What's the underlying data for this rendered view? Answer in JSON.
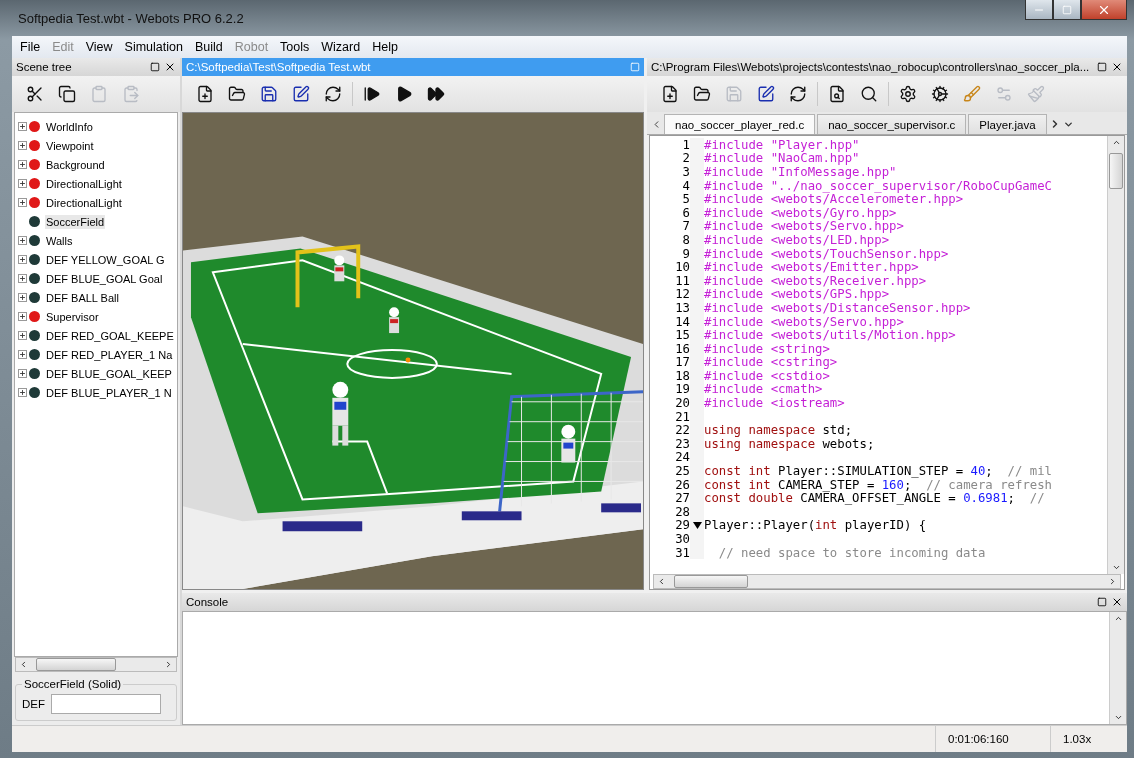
{
  "window": {
    "title": "Softpedia Test.wbt - Webots PRO 6.2.2"
  },
  "menu": [
    {
      "label": "File",
      "disabled": false
    },
    {
      "label": "Edit",
      "disabled": true
    },
    {
      "label": "View",
      "disabled": false
    },
    {
      "label": "Simulation",
      "disabled": false
    },
    {
      "label": "Build",
      "disabled": false
    },
    {
      "label": "Robot",
      "disabled": true
    },
    {
      "label": "Tools",
      "disabled": false
    },
    {
      "label": "Wizard",
      "disabled": false
    },
    {
      "label": "Help",
      "disabled": false
    }
  ],
  "scene_tree": {
    "title": "Scene tree",
    "toolbar": [
      {
        "kind": "cut",
        "disabled": false
      },
      {
        "kind": "copy",
        "disabled": false
      },
      {
        "kind": "paste",
        "disabled": true
      },
      {
        "kind": "insert",
        "disabled": true
      }
    ],
    "nodes": [
      {
        "label": "WorldInfo",
        "color": "#e01818",
        "expandable": true,
        "selected": false
      },
      {
        "label": "Viewpoint",
        "color": "#e01818",
        "expandable": true,
        "selected": false
      },
      {
        "label": "Background",
        "color": "#e01818",
        "expandable": true,
        "selected": false
      },
      {
        "label": "DirectionalLight",
        "color": "#e01818",
        "expandable": true,
        "selected": false
      },
      {
        "label": "DirectionalLight",
        "color": "#e01818",
        "expandable": true,
        "selected": false
      },
      {
        "label": "SoccerField",
        "color": "#1f3a38",
        "expandable": false,
        "selected": true
      },
      {
        "label": "Walls",
        "color": "#1f3a38",
        "expandable": true,
        "selected": false
      },
      {
        "label": "DEF YELLOW_GOAL G",
        "color": "#1f3a38",
        "expandable": true,
        "selected": false
      },
      {
        "label": "DEF BLUE_GOAL Goal",
        "color": "#1f3a38",
        "expandable": true,
        "selected": false
      },
      {
        "label": "DEF BALL Ball",
        "color": "#1f3a38",
        "expandable": true,
        "selected": false
      },
      {
        "label": "Supervisor",
        "color": "#e01818",
        "expandable": true,
        "selected": false
      },
      {
        "label": "DEF RED_GOAL_KEEPE",
        "color": "#1f3a38",
        "expandable": true,
        "selected": false
      },
      {
        "label": "DEF RED_PLAYER_1 Na",
        "color": "#1f3a38",
        "expandable": true,
        "selected": false
      },
      {
        "label": "DEF BLUE_GOAL_KEEP",
        "color": "#1f3a38",
        "expandable": true,
        "selected": false
      },
      {
        "label": "DEF BLUE_PLAYER_1 N",
        "color": "#1f3a38",
        "expandable": true,
        "selected": false
      }
    ],
    "properties": {
      "title": "SoccerField (Solid)",
      "field_label": "DEF"
    }
  },
  "view3d": {
    "title": "C:\\Softpedia\\Test\\Softpedia Test.wbt",
    "active": true,
    "toolbar": [
      {
        "kind": "new",
        "disabled": false
      },
      {
        "kind": "open",
        "disabled": false
      },
      {
        "kind": "save",
        "disabled": false
      },
      {
        "kind": "save_as",
        "disabled": false
      },
      {
        "kind": "revert",
        "disabled": false
      },
      {
        "kind": "step",
        "disabled": false
      },
      {
        "kind": "run",
        "disabled": false
      },
      {
        "kind": "fast",
        "disabled": false
      }
    ]
  },
  "editor": {
    "title": "C:\\Program Files\\Webots\\projects\\contests\\nao_robocup\\controllers\\nao_soccer_pla...",
    "active": false,
    "toolbar": [
      {
        "kind": "new",
        "disabled": false
      },
      {
        "kind": "open",
        "disabled": false
      },
      {
        "kind": "save",
        "disabled": true
      },
      {
        "kind": "save_as",
        "disabled": false
      },
      {
        "kind": "revert",
        "disabled": false
      },
      {
        "kind": "find",
        "disabled": false
      },
      {
        "kind": "replace",
        "disabled": false
      },
      {
        "kind": "build",
        "disabled": false
      },
      {
        "kind": "compile",
        "disabled": false
      },
      {
        "kind": "clean",
        "disabled": false
      },
      {
        "kind": "cross_compile",
        "disabled": true
      },
      {
        "kind": "cross_clean",
        "disabled": true
      }
    ],
    "tabs": [
      {
        "label": "nao_soccer_player_red.c",
        "selected": true
      },
      {
        "label": "nao_soccer_supervisor.c",
        "selected": false
      },
      {
        "label": "Player.java",
        "selected": false
      }
    ],
    "lines": [
      {
        "number": "1",
        "fold": false,
        "tokens": [
          {
            "kind": "directive",
            "text": "#include \"Player.hpp\""
          }
        ]
      },
      {
        "number": "2",
        "fold": false,
        "tokens": [
          {
            "kind": "directive",
            "text": "#include \"NaoCam.hpp\""
          }
        ]
      },
      {
        "number": "3",
        "fold": false,
        "tokens": [
          {
            "kind": "directive",
            "text": "#include \"InfoMessage.hpp\""
          }
        ]
      },
      {
        "number": "4",
        "fold": false,
        "tokens": [
          {
            "kind": "directive",
            "text": "#include \"../nao_soccer_supervisor/RoboCupGameC"
          }
        ]
      },
      {
        "number": "5",
        "fold": false,
        "tokens": [
          {
            "kind": "directive",
            "text": "#include <webots/Accelerometer.hpp>"
          }
        ]
      },
      {
        "number": "6",
        "fold": false,
        "tokens": [
          {
            "kind": "directive",
            "text": "#include <webots/Gyro.hpp>"
          }
        ]
      },
      {
        "number": "7",
        "fold": false,
        "tokens": [
          {
            "kind": "directive",
            "text": "#include <webots/Servo.hpp>"
          }
        ]
      },
      {
        "number": "8",
        "fold": false,
        "tokens": [
          {
            "kind": "directive",
            "text": "#include <webots/LED.hpp>"
          }
        ]
      },
      {
        "number": "9",
        "fold": false,
        "tokens": [
          {
            "kind": "directive",
            "text": "#include <webots/TouchSensor.hpp>"
          }
        ]
      },
      {
        "number": "10",
        "fold": false,
        "tokens": [
          {
            "kind": "directive",
            "text": "#include <webots/Emitter.hpp>"
          }
        ]
      },
      {
        "number": "11",
        "fold": false,
        "tokens": [
          {
            "kind": "directive",
            "text": "#include <webots/Receiver.hpp>"
          }
        ]
      },
      {
        "number": "12",
        "fold": false,
        "tokens": [
          {
            "kind": "directive",
            "text": "#include <webots/GPS.hpp>"
          }
        ]
      },
      {
        "number": "13",
        "fold": false,
        "tokens": [
          {
            "kind": "directive",
            "text": "#include <webots/DistanceSensor.hpp>"
          }
        ]
      },
      {
        "number": "14",
        "fold": false,
        "tokens": [
          {
            "kind": "directive",
            "text": "#include <webots/Servo.hpp>"
          }
        ]
      },
      {
        "number": "15",
        "fold": false,
        "tokens": [
          {
            "kind": "directive",
            "text": "#include <webots/utils/Motion.hpp>"
          }
        ]
      },
      {
        "number": "16",
        "fold": false,
        "tokens": [
          {
            "kind": "directive",
            "text": "#include <string>"
          }
        ]
      },
      {
        "number": "17",
        "fold": false,
        "tokens": [
          {
            "kind": "directive",
            "text": "#include <cstring>"
          }
        ]
      },
      {
        "number": "18",
        "fold": false,
        "tokens": [
          {
            "kind": "directive",
            "text": "#include <cstdio>"
          }
        ]
      },
      {
        "number": "19",
        "fold": false,
        "tokens": [
          {
            "kind": "directive",
            "text": "#include <cmath>"
          }
        ]
      },
      {
        "number": "20",
        "fold": false,
        "tokens": [
          {
            "kind": "directive",
            "text": "#include <iostream>"
          }
        ]
      },
      {
        "number": "21",
        "fold": false
      },
      {
        "number": "22",
        "fold": false,
        "tokens": [
          {
            "kind": "keyword",
            "text": "using namespace"
          },
          {
            "kind": "plain",
            "text": " std;"
          }
        ]
      },
      {
        "number": "23",
        "fold": false,
        "tokens": [
          {
            "kind": "keyword",
            "text": "using namespace"
          },
          {
            "kind": "plain",
            "text": " webots;"
          }
        ]
      },
      {
        "number": "24",
        "fold": false
      },
      {
        "number": "25",
        "fold": false,
        "tokens": [
          {
            "kind": "keyword",
            "text": "const int"
          },
          {
            "kind": "plain",
            "text": " Player::SIMULATION_STEP = "
          },
          {
            "kind": "number",
            "text": "40"
          },
          {
            "kind": "plain",
            "text": ";  "
          },
          {
            "kind": "comment",
            "text": "// mil"
          }
        ]
      },
      {
        "number": "26",
        "fold": false,
        "tokens": [
          {
            "kind": "keyword",
            "text": "const int"
          },
          {
            "kind": "plain",
            "text": " CAMERA_STEP = "
          },
          {
            "kind": "number",
            "text": "160"
          },
          {
            "kind": "plain",
            "text": ";  "
          },
          {
            "kind": "comment",
            "text": "// camera refresh"
          }
        ]
      },
      {
        "number": "27",
        "fold": false,
        "tokens": [
          {
            "kind": "keyword",
            "text": "const double"
          },
          {
            "kind": "plain",
            "text": " CAMERA_OFFSET_ANGLE = "
          },
          {
            "kind": "number",
            "text": "0.6981"
          },
          {
            "kind": "plain",
            "text": ";  "
          },
          {
            "kind": "comment",
            "text": "//"
          }
        ]
      },
      {
        "number": "28",
        "fold": false
      },
      {
        "number": "29",
        "fold": true,
        "tokens": [
          {
            "kind": "plain",
            "text": "Player::Player("
          },
          {
            "kind": "keyword",
            "text": "int"
          },
          {
            "kind": "plain",
            "text": " playerID) {"
          }
        ]
      },
      {
        "number": "30",
        "fold": false
      },
      {
        "number": "31",
        "fold": false,
        "tokens": [
          {
            "kind": "comment",
            "text": "  // need space to store incoming data"
          }
        ]
      }
    ]
  },
  "console": {
    "title": "Console"
  },
  "status_bar": {
    "time": "0:01:06:160",
    "speed": "1.03x"
  }
}
